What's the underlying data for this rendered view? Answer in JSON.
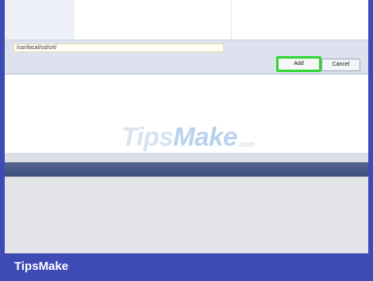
{
  "dialog": {
    "path_value": "/usr/local/ssl/crt/",
    "add_label": "Add",
    "cancel_label": "Cancel"
  },
  "watermark": {
    "text": "Tips",
    "accent": "Make",
    "suffix": ".com"
  },
  "brand": "TipsMake",
  "colors": {
    "frame_background": "#3e4bb5",
    "highlight": "#2fd531"
  }
}
